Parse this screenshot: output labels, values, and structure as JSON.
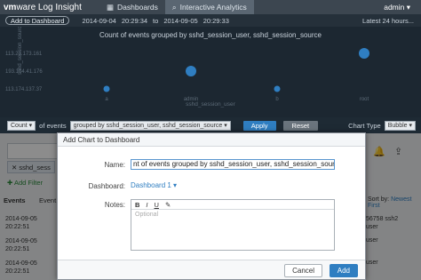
{
  "topbar": {
    "brand_vm": "vm",
    "brand_ware": "ware",
    "brand_product": "Log Insight",
    "nav": [
      {
        "label": "Dashboards"
      },
      {
        "label": "Interactive Analytics"
      }
    ],
    "user": "admin ▾"
  },
  "subbar": {
    "add_to_dashboard": "Add to Dashboard",
    "date1": "2014-09-04",
    "time1": "20:29:34",
    "to": "to",
    "date2": "2014-09-05",
    "time2": "20:29:33",
    "latest": "Latest 24 hours..."
  },
  "chart": {
    "title": "Count of events grouped by sshd_session_user, sshd_session_source",
    "ylabel": "sshd_session_source",
    "xlabel": "sshd_session_user"
  },
  "chart_data": {
    "type": "scatter",
    "title": "Count of events grouped by sshd_session_user, sshd_session_source",
    "xlabel": "sshd_session_user",
    "ylabel": "sshd_session_source",
    "categories_x": [
      "a",
      "admin",
      "b",
      "root"
    ],
    "categories_y": [
      "113.174.137.37",
      "193.104.41.176",
      "113.21.173.161"
    ],
    "points": [
      {
        "x": "a",
        "y": "113.174.137.37",
        "size": 1
      },
      {
        "x": "admin",
        "y": "193.104.41.176",
        "size": 2
      },
      {
        "x": "b",
        "y": "113.174.137.37",
        "size": 1
      },
      {
        "x": "root",
        "y": "113.21.173.161",
        "size": 2
      }
    ],
    "colors": {
      "bubble": "#2f7ec1"
    }
  },
  "controls": {
    "count_label": "Count",
    "of_events": "of events",
    "group_select": "grouped by sshd_session_user, sshd_session_source",
    "apply": "Apply",
    "reset": "Reset",
    "chart_type_label": "Chart Type",
    "chart_type_value": "Bubble"
  },
  "bg": {
    "filter_chip": "sshd_sess",
    "add_filter": "Add Filter",
    "tabs": [
      "Events",
      "Event"
    ],
    "sort_label": "Sort by:",
    "sort_value": "Newest First",
    "rows": [
      {
        "date": "2014-09-05",
        "time": "20:22:51",
        "right": "56758 ssh2",
        "right2": "user"
      },
      {
        "date": "2014-09-05",
        "time": "20:22:51",
        "right": "user",
        "right2": ""
      },
      {
        "date": "2014-09-05",
        "time": "20:22:51",
        "right": "user",
        "right2": ""
      }
    ]
  },
  "modal": {
    "title": "Add Chart to Dashboard",
    "name_label": "Name:",
    "name_value": "nt of events grouped by sshd_session_user, sshd_session_source",
    "dashboard_label": "Dashboard:",
    "dashboard_value": "Dashboard 1 ▾",
    "notes_label": "Notes:",
    "notes_placeholder": "Optional",
    "toolbar": [
      "B",
      "I",
      "U",
      "✎"
    ],
    "cancel": "Cancel",
    "add": "Add"
  }
}
